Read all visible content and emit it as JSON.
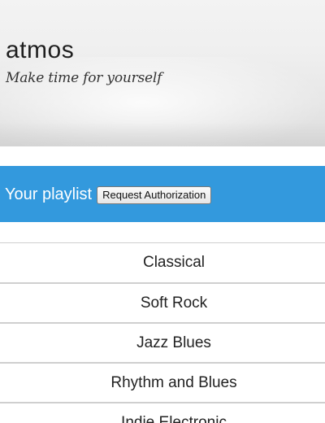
{
  "header": {
    "brand": "atmos",
    "tagline": "Make time for yourself"
  },
  "playlist": {
    "title": "Your playlist",
    "auth_button_label": "Request Authorization"
  },
  "genres": [
    {
      "label": "Classical"
    },
    {
      "label": "Soft Rock"
    },
    {
      "label": "Jazz Blues"
    },
    {
      "label": "Rhythm and Blues"
    },
    {
      "label": "Indie Electronic"
    }
  ],
  "colors": {
    "accent": "#3399dd",
    "divider": "#cfcfcf",
    "text": "#222222"
  }
}
